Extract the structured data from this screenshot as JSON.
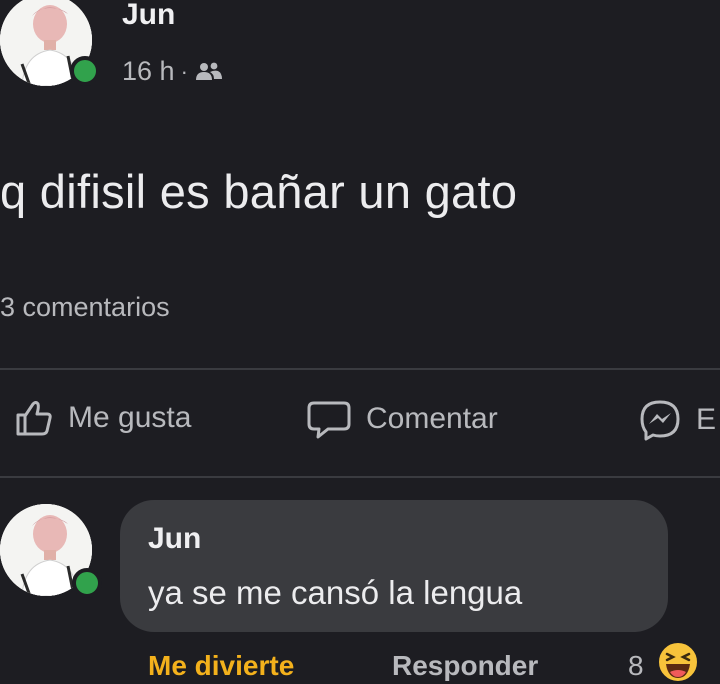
{
  "post": {
    "author": "Jun",
    "time": "16 h",
    "separator": "·",
    "audience_icon": "friends-icon",
    "text": "q difisil es bañar un gato",
    "comment_count": "3 comentarios"
  },
  "actions": {
    "like_label": "Me gusta",
    "comment_label": "Comentar",
    "send_label": "E",
    "like_icon": "thumbs-up-icon",
    "comment_icon": "speech-bubble-icon",
    "send_icon": "messenger-icon"
  },
  "comment": {
    "author": "Jun",
    "text": "ya se me cansó la lengua",
    "reaction_label": "Me divierte",
    "reply_label": "Responder",
    "reaction_count": "8",
    "reaction_icon": "haha-emoji-icon"
  },
  "colors": {
    "background": "#1d1d22",
    "bubble": "#3a3b3f",
    "online": "#31a24c",
    "reaction": "#f3b11c",
    "secondary_text": "#b8b9bd"
  }
}
